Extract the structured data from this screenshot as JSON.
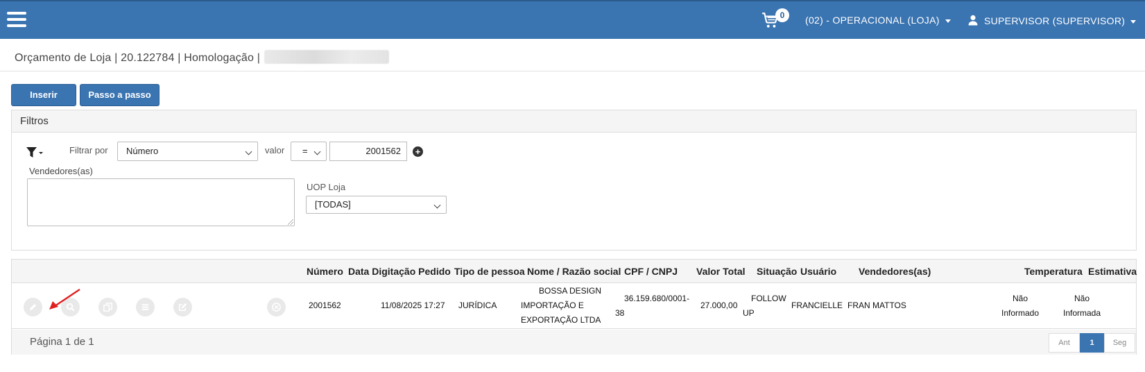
{
  "header": {
    "cart_count": "0",
    "store_menu": "(02) - OPERACIONAL (LOJA)",
    "user_menu": "SUPERVISOR (SUPERVISOR)"
  },
  "page": {
    "title": "Orçamento de Loja | 20.122784 | Homologação |"
  },
  "toolbar": {
    "insert_label": "Inserir",
    "wizard_label": "Passo a passo"
  },
  "filters": {
    "heading": "Filtros",
    "filter_by_label": "Filtrar por",
    "filter_by_value": "Número",
    "value_label": "valor",
    "operator_value": "=",
    "filter_value": "2001562",
    "sellers_label": "Vendedores(as)",
    "uop_label": "UOP Loja",
    "uop_value": "[TODAS]"
  },
  "table": {
    "columns": {
      "numero": "Número",
      "data": "Data Digitação Pedido",
      "tipo": "Tipo de pessoa",
      "nome": "Nome / Razão social",
      "cpf": "CPF / CNPJ",
      "valor": "Valor Total",
      "situacao": "Situação",
      "usuario": "Usuário",
      "vendedores": "Vendedores(as)",
      "temperatura": "Temperatura",
      "estimativa": "Estimativa"
    },
    "rows": [
      {
        "numero": "2001562",
        "data": "11/08/2025 17:27",
        "tipo": "JURÍDICA",
        "nome_l1": "BOSSA DESIGN",
        "nome_l2": "IMPORTAÇÃO E",
        "nome_l3": "EXPORTAÇÃO LTDA",
        "cpf_l1": "36.159.680/0001-",
        "cpf_l2": "38",
        "valor": "27.000,00",
        "situacao_l1": "FOLLOW",
        "situacao_l2": "UP",
        "usuario": "FRANCIELLE",
        "vendedores": "FRAN MATTOS",
        "temperatura_l1": "Não",
        "temperatura_l2": "Informado",
        "estimativa_l1": "Não",
        "estimativa_l2": "Informada"
      }
    ],
    "page_info": "Página 1 de 1",
    "pager": {
      "prev": "Ant",
      "current": "1",
      "next": "Seg"
    }
  },
  "colors": {
    "primary": "#3a74b1",
    "annotation_arrow": "#e02020"
  }
}
